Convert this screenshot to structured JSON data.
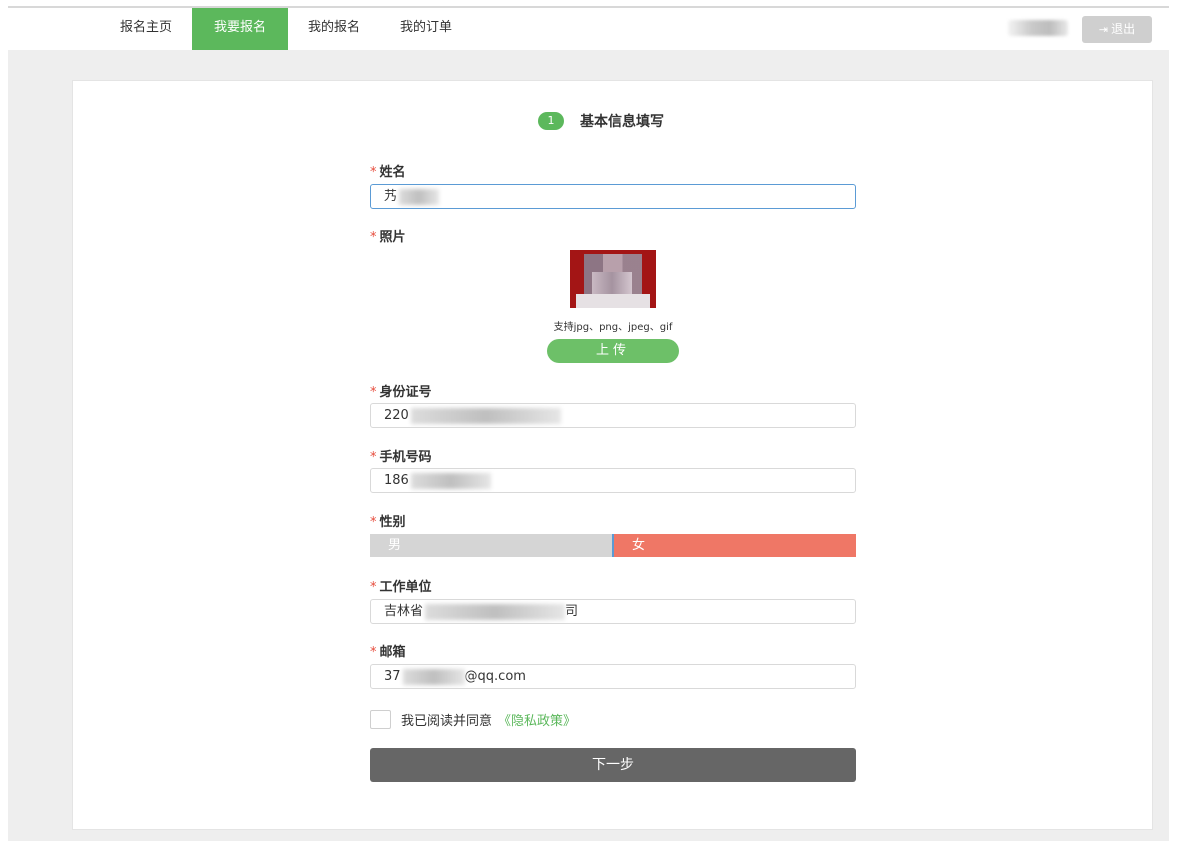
{
  "nav": {
    "items": [
      {
        "label": "报名主页",
        "active": false
      },
      {
        "label": "我要报名",
        "active": true
      },
      {
        "label": "我的报名",
        "active": false
      },
      {
        "label": "我的订单",
        "active": false
      }
    ],
    "logout_label": "退出",
    "logout_icon": "sign-out-icon"
  },
  "step": {
    "number": "1",
    "title": "基本信息填写"
  },
  "form": {
    "required_mark": "*",
    "name": {
      "label": "姓名",
      "value": "艿"
    },
    "photo": {
      "label": "照片",
      "hint": "支持jpg、png、jpeg、gif",
      "upload_label": "上传"
    },
    "id_number": {
      "label": "身份证号",
      "value": "220"
    },
    "phone": {
      "label": "手机号码",
      "value": "186"
    },
    "gender": {
      "label": "性别",
      "options": [
        "男",
        "女"
      ],
      "selected": "女"
    },
    "work_unit": {
      "label": "工作单位",
      "value": "吉林省",
      "value_suffix": "司"
    },
    "email": {
      "label": "邮箱",
      "value_prefix": "37",
      "value_suffix": "@qq.com"
    }
  },
  "agreement": {
    "text": "我已阅读并同意",
    "link": "《隐私政策》"
  },
  "next_button": "下一步",
  "colors": {
    "accent_green": "#5cb85c",
    "female_selected": "#ef7766",
    "required_red": "#e74c3c",
    "next_button": "#666666"
  }
}
